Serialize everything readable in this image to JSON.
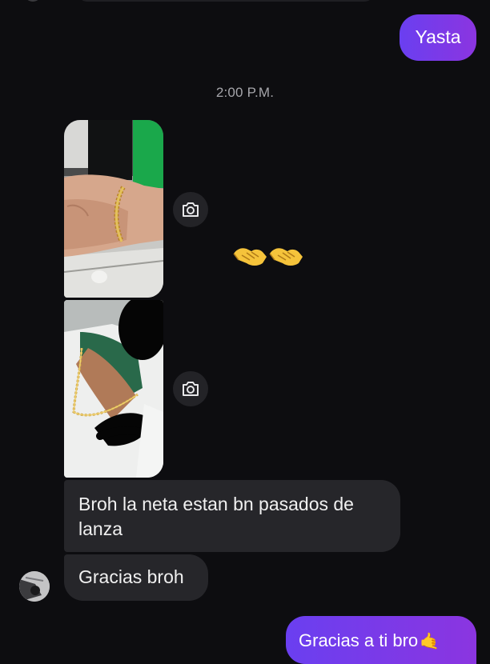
{
  "conversation": {
    "sent_top": {
      "text": "Yasta"
    },
    "timestamp": "2:00 P.M.",
    "received": {
      "reaction_emoji": "🤝🤝",
      "messages": [
        {
          "text": "Broh la neta estan bn pasados de lanza"
        },
        {
          "text": "Gracias broh"
        }
      ]
    },
    "sent_bottom": {
      "text": "Gracias a ti bro",
      "emoji": "🤙"
    }
  },
  "icons": {
    "camera": "camera-icon",
    "reaction": "handshake-icon"
  },
  "colors": {
    "background": "#0d0d10",
    "sent_bubble": "#7b3ce6",
    "received_bubble": "#26262a",
    "timestamp": "#a6a6ab"
  }
}
